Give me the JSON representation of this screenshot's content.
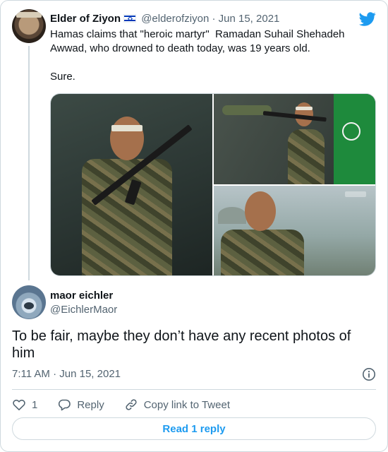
{
  "quoted_tweet": {
    "author_name": "Elder of Ziyon",
    "flag_icon": "israel-flag-icon",
    "handle": "@elderofziyon",
    "separator": "·",
    "date": "Jun 15, 2021",
    "text": "Hamas claims that \"heroic martyr\"  Ramadan Suhail Shehadeh Awwad, who drowned to death today, was 19 years old.\n\nSure.",
    "photos": [
      "photo-armed-youth-portrait",
      "photo-youth-with-rpg-and-flag",
      "photo-youth-portrait-landscape"
    ]
  },
  "brand_icon": "twitter-bird-icon",
  "reply_tweet": {
    "author_name": "maor eichler",
    "handle": "@EichlerMaor",
    "text": "To be fair, maybe they don’t have any recent photos of him",
    "time": "7:11 AM",
    "separator": "·",
    "date": "Jun 15, 2021"
  },
  "actions": {
    "like_count": "1",
    "reply_label": "Reply",
    "copy_link_label": "Copy link to Tweet"
  },
  "read_more_label": "Read 1 reply",
  "colors": {
    "accent": "#1d9bf0",
    "text_primary": "#0f1419",
    "text_secondary": "#536471",
    "border": "#cfd9de"
  }
}
